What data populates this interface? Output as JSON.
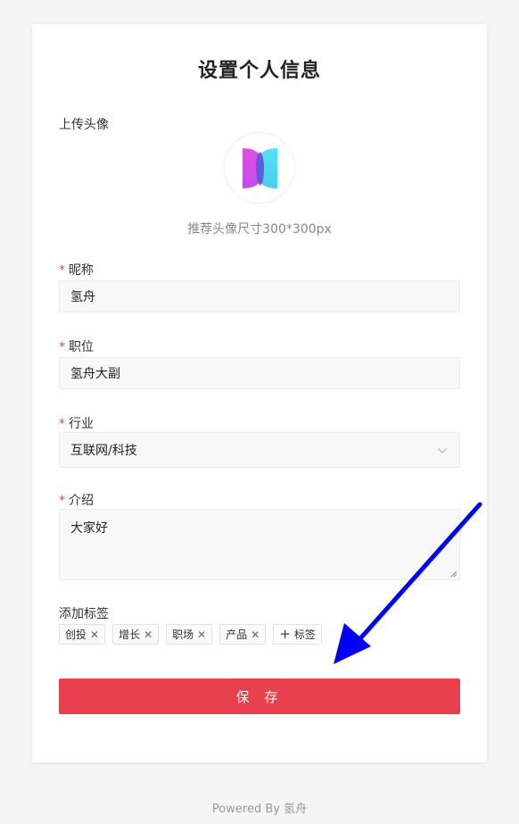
{
  "page": {
    "title": "设置个人信息"
  },
  "avatar": {
    "label": "上传头像",
    "hint": "推荐头像尺寸300*300px"
  },
  "fields": {
    "nickname": {
      "required_mark": "*",
      "label": "昵称",
      "value": "氢舟"
    },
    "position": {
      "required_mark": "*",
      "label": "职位",
      "value": "氢舟大副"
    },
    "industry": {
      "required_mark": "*",
      "label": "行业",
      "value": "互联网/科技"
    },
    "intro": {
      "required_mark": "*",
      "label": "介绍",
      "value": "大家好"
    }
  },
  "tags": {
    "label": "添加标签",
    "items": [
      "创投",
      "增长",
      "职场",
      "产品"
    ],
    "add_label": "标签"
  },
  "save_label": "保 存",
  "footer": "Powered By 氢舟",
  "colors": {
    "accent": "#e8414d",
    "annotation_arrow": "#0000ff"
  }
}
